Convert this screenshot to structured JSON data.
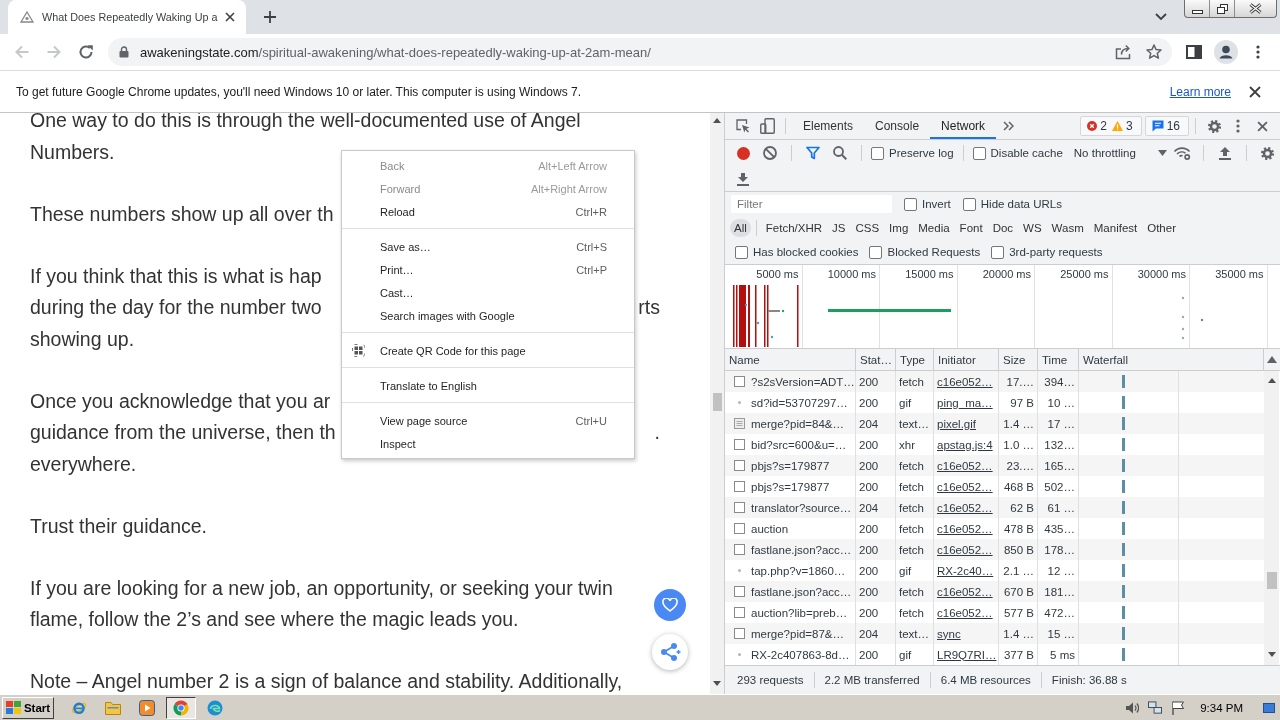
{
  "window": {
    "tabs": [
      {
        "title": "What Does Repeatedly Waking Up a",
        "selected": true
      }
    ]
  },
  "toolbar": {
    "navigation": [
      {
        "kind": "back",
        "disabled": true
      },
      {
        "kind": "forward",
        "disabled": true
      },
      {
        "kind": "reload",
        "disabled": false
      }
    ],
    "url": {
      "host": "awakeningstate.com",
      "path": "/spiritual-awakening/what-does-repeatedly-waking-up-at-2am-mean/"
    }
  },
  "infobar": {
    "message": "To get future Google Chrome updates, you'll need Windows 10 or later. This computer is using Windows 7.",
    "link": "Learn more"
  },
  "article": {
    "paragraphs": [
      {
        "lines": [
          [
            "One way to do this is through the well-documented use of Angel"
          ],
          [
            "Numbers."
          ]
        ]
      },
      {
        "lines": [
          [
            "These numbers show up all over th"
          ]
        ]
      },
      {
        "lines": [
          [
            "If you think that this is what is hap"
          ],
          [
            "during the day for the number two",
            "rts"
          ],
          [
            "showing up."
          ]
        ]
      },
      {
        "lines": [
          [
            "Once you acknowledge that you ar"
          ],
          [
            "guidance from the universe, then th",
            "."
          ],
          [
            "everywhere."
          ]
        ]
      },
      {
        "lines": [
          [
            "Trust their guidance."
          ]
        ]
      },
      {
        "lines": [
          [
            "If you are looking for a new job, an opportunity, or seeking your twin"
          ],
          [
            "flame, follow the 2’s and see where the magic leads you."
          ]
        ]
      },
      {
        "lines": [
          [
            "Note – Angel number 2 is a sign of balance and stability. Additionally,"
          ]
        ]
      }
    ]
  },
  "context_menu": {
    "groups": [
      [
        {
          "kind": "plain",
          "label": "Back",
          "shortcut": "Alt+Left Arrow",
          "disabled": true
        },
        {
          "kind": "plain",
          "label": "Forward",
          "shortcut": "Alt+Right Arrow",
          "disabled": true
        },
        {
          "kind": "plain",
          "label": "Reload",
          "shortcut": "Ctrl+R",
          "disabled": false
        }
      ],
      [
        {
          "kind": "plain",
          "label": "Save as…",
          "shortcut": "Ctrl+S",
          "disabled": false
        },
        {
          "kind": "plain",
          "label": "Print…",
          "shortcut": "Ctrl+P",
          "disabled": false
        },
        {
          "kind": "plain",
          "label": "Cast…",
          "disabled": false
        },
        {
          "kind": "plain",
          "label": "Search images with Google",
          "disabled": false
        }
      ],
      [
        {
          "kind": "qr",
          "label": "Create QR Code for this page",
          "disabled": false
        }
      ],
      [
        {
          "kind": "plain",
          "label": "Translate to English",
          "disabled": false
        }
      ],
      [
        {
          "kind": "plain",
          "label": "View page source",
          "shortcut": "Ctrl+U",
          "disabled": false
        },
        {
          "kind": "plain",
          "label": "Inspect",
          "disabled": false
        }
      ]
    ]
  },
  "devtools": {
    "tabs": [
      {
        "label": "Elements",
        "selected": false
      },
      {
        "label": "Console",
        "selected": false
      },
      {
        "label": "Network",
        "selected": true
      }
    ],
    "errors": "2",
    "warnings": "3",
    "messages": "16",
    "recording": true,
    "filter_shown": true,
    "options": [
      {
        "label": "Preserve log",
        "checked": false
      },
      {
        "label": "Disable cache",
        "checked": false
      }
    ],
    "throttling": "No throttling",
    "filter": {
      "placeholder": "Filter"
    },
    "filter_options": [
      {
        "label": "Invert",
        "checked": false
      },
      {
        "label": "Hide data URLs",
        "checked": false
      }
    ],
    "types": [
      {
        "label": "All",
        "selected": true
      },
      {
        "label": "Fetch/XHR",
        "selected": false
      },
      {
        "label": "JS",
        "selected": false
      },
      {
        "label": "CSS",
        "selected": false
      },
      {
        "label": "Img",
        "selected": false
      },
      {
        "label": "Media",
        "selected": false
      },
      {
        "label": "Font",
        "selected": false
      },
      {
        "label": "Doc",
        "selected": false
      },
      {
        "label": "WS",
        "selected": false
      },
      {
        "label": "Wasm",
        "selected": false
      },
      {
        "label": "Manifest",
        "selected": false
      },
      {
        "label": "Other",
        "selected": false
      }
    ],
    "blocked_options": [
      {
        "label": "Has blocked cookies",
        "checked": false
      },
      {
        "label": "Blocked Requests",
        "checked": false
      },
      {
        "label": "3rd-party requests",
        "checked": false
      }
    ],
    "overview": {
      "ticks": [
        "5000 ms",
        "10000 ms",
        "15000 ms",
        "20000 ms",
        "25000 ms",
        "30000 ms",
        "35000 ms"
      ]
    },
    "table": {
      "columns": [
        "Name",
        "Stat…",
        "Type",
        "Initiator",
        "Size",
        "Time",
        "Waterfall"
      ],
      "rows": [
        {
          "kind": "file",
          "name": "?s2sVersion=ADT…",
          "status": "200",
          "type": "fetch",
          "initiator": "c16e052…",
          "size": "17.…",
          "time": "394…"
        },
        {
          "kind": "pixel",
          "name": "sd?id=53707297…",
          "status": "200",
          "type": "gif",
          "initiator": "ping_ma…",
          "size": "97 B",
          "time": "10 …"
        },
        {
          "kind": "document",
          "name": "merge?pid=84&…",
          "status": "204",
          "type": "text…",
          "initiator": "pixel.gif",
          "size": "1.4 …",
          "time": "17 …"
        },
        {
          "kind": "file",
          "name": "bid?src=600&u=…",
          "status": "200",
          "type": "xhr",
          "initiator": "apstag.js:4",
          "size": "1.0 …",
          "time": "132…"
        },
        {
          "kind": "file",
          "name": "pbjs?s=179877",
          "status": "200",
          "type": "fetch",
          "initiator": "c16e052…",
          "size": "23.…",
          "time": "165…"
        },
        {
          "kind": "file",
          "name": "pbjs?s=179877",
          "status": "200",
          "type": "fetch",
          "initiator": "c16e052…",
          "size": "468 B",
          "time": "502…"
        },
        {
          "kind": "file",
          "name": "translator?source…",
          "status": "204",
          "type": "fetch",
          "initiator": "c16e052…",
          "size": "62 B",
          "time": "61 …"
        },
        {
          "kind": "file",
          "name": "auction",
          "status": "200",
          "type": "fetch",
          "initiator": "c16e052…",
          "size": "478 B",
          "time": "435…"
        },
        {
          "kind": "file",
          "name": "fastlane.json?acc…",
          "status": "200",
          "type": "fetch",
          "initiator": "c16e052…",
          "size": "850 B",
          "time": "178…"
        },
        {
          "kind": "pixel",
          "name": "tap.php?v=1860…",
          "status": "200",
          "type": "gif",
          "initiator": "RX-2c40…",
          "size": "2.1 …",
          "time": "12 …"
        },
        {
          "kind": "file",
          "name": "fastlane.json?acc…",
          "status": "200",
          "type": "fetch",
          "initiator": "c16e052…",
          "size": "670 B",
          "time": "181…"
        },
        {
          "kind": "file",
          "name": "auction?lib=preb…",
          "status": "200",
          "type": "fetch",
          "initiator": "c16e052…",
          "size": "577 B",
          "time": "472…"
        },
        {
          "kind": "file",
          "name": "merge?pid=87&…",
          "status": "204",
          "type": "text…",
          "initiator": "sync",
          "size": "1.4 …",
          "time": "15 …"
        },
        {
          "kind": "pixel",
          "name": "RX-2c407863-8d…",
          "status": "200",
          "type": "gif",
          "initiator": "LR9Q7RI…",
          "size": "377 B",
          "time": "5 ms"
        }
      ]
    },
    "status": [
      "293 requests",
      "2.2 MB transferred",
      "6.4 MB resources",
      "Finish: 36.88 s"
    ]
  },
  "taskbar": {
    "start": "Start",
    "apps": [
      {
        "kind": "ie",
        "selected": false
      },
      {
        "kind": "folder",
        "selected": false
      },
      {
        "kind": "media",
        "selected": false
      },
      {
        "kind": "chrome",
        "selected": true
      },
      {
        "kind": "edge",
        "selected": false
      }
    ],
    "clock": "9:34 PM"
  }
}
